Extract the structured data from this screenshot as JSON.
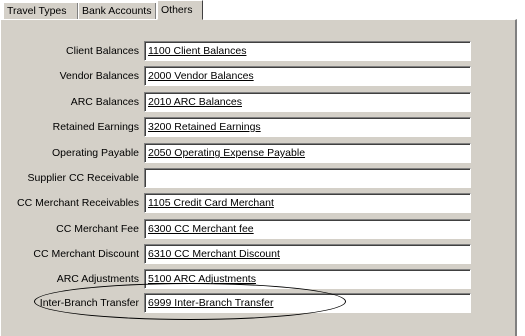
{
  "tabs": [
    "Travel Types",
    "Bank Accounts",
    "Others"
  ],
  "rows": [
    {
      "label": "Client Balances",
      "value": "1100  Client Balances"
    },
    {
      "label": "Vendor Balances",
      "value": "2000  Vendor Balances"
    },
    {
      "label": "ARC Balances",
      "value": "2010  ARC Balances"
    },
    {
      "label": "Retained Earnings",
      "value": "3200  Retained Earnings"
    },
    {
      "label": "Operating Payable",
      "value": "2050  Operating Expense Payable"
    },
    {
      "label": "Supplier CC Receivable",
      "value": ""
    },
    {
      "label": "CC Merchant Receivables",
      "value": "1105  Credit Card Merchant"
    },
    {
      "label": "CC Merchant Fee",
      "value": "6300  CC Merchant fee"
    },
    {
      "label": "CC Merchant Discount",
      "value": "6310  CC Merchant Discount"
    },
    {
      "label": "ARC Adjustments",
      "value": "5100  ARC Adjustments"
    },
    {
      "label": "Inter-Branch Transfer",
      "value": "6999  Inter-Branch Transfer"
    }
  ]
}
